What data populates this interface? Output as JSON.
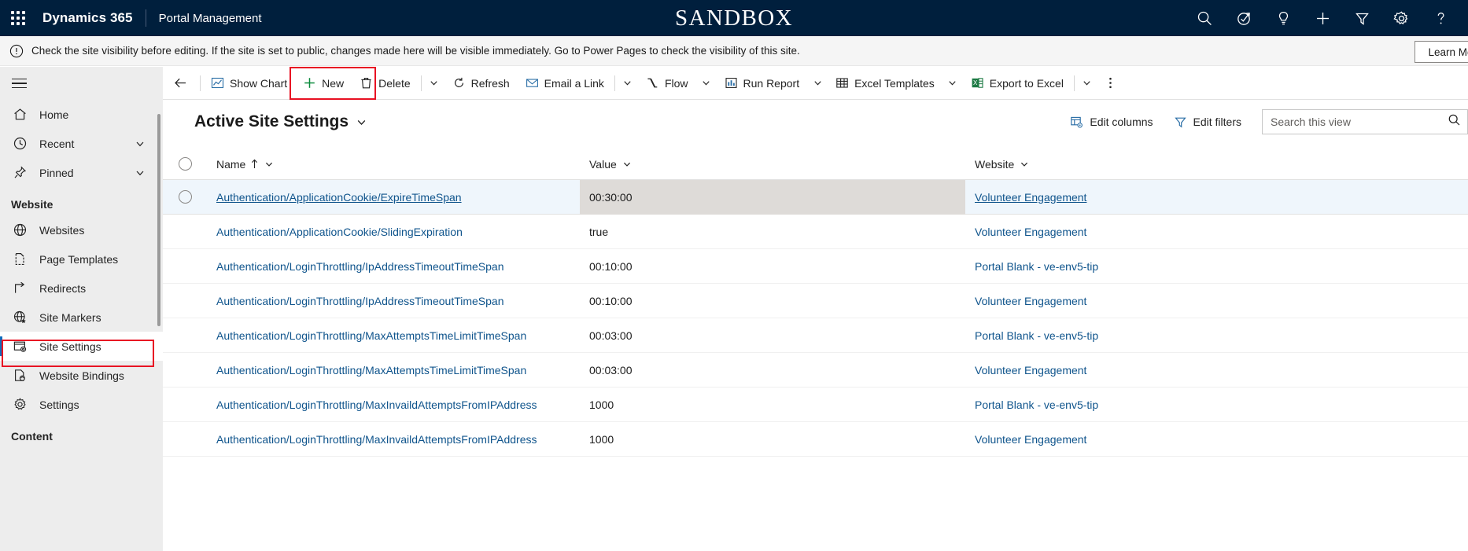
{
  "appbar": {
    "brand": "Dynamics 365",
    "app_name": "Portal Management",
    "environment_badge": "SANDBOX",
    "icons": [
      {
        "name": "search-icon",
        "label": "Search"
      },
      {
        "name": "diagnostics-icon",
        "label": "Diagnostics"
      },
      {
        "name": "lightbulb-icon",
        "label": "Assistant"
      },
      {
        "name": "plus-icon",
        "label": "Quick create"
      },
      {
        "name": "filter-icon",
        "label": "Filter"
      },
      {
        "name": "gear-icon",
        "label": "Settings"
      },
      {
        "name": "help-icon",
        "label": "Help"
      }
    ]
  },
  "notification": {
    "text": "Check the site visibility before editing. If the site is set to public, changes made here will be visible immediately. Go to Power Pages to check the visibility of this site.",
    "action_label": "Learn More"
  },
  "sidebar": {
    "top_items": [
      {
        "label": "Home",
        "icon": "home-icon",
        "chevron": false
      },
      {
        "label": "Recent",
        "icon": "clock-icon",
        "chevron": true
      },
      {
        "label": "Pinned",
        "icon": "pin-icon",
        "chevron": true
      }
    ],
    "group_website": "Website",
    "website_items": [
      {
        "label": "Websites",
        "icon": "globe-icon",
        "selected": false
      },
      {
        "label": "Page Templates",
        "icon": "page-icon",
        "selected": false
      },
      {
        "label": "Redirects",
        "icon": "redirect-icon",
        "selected": false
      },
      {
        "label": "Site Markers",
        "icon": "globe-star-icon",
        "selected": false
      },
      {
        "label": "Site Settings",
        "icon": "site-settings-icon",
        "selected": true
      },
      {
        "label": "Website Bindings",
        "icon": "binding-icon",
        "selected": false
      },
      {
        "label": "Settings",
        "icon": "gear-icon",
        "selected": false
      }
    ],
    "group_content": "Content"
  },
  "commandbar": {
    "back_label": "Back",
    "items": [
      {
        "label": "Show Chart",
        "icon": "chart-icon",
        "chevron": false,
        "sep_after": false
      },
      {
        "label": "New",
        "icon": "plus-icon",
        "chevron": false,
        "sep_after": false
      },
      {
        "label": "Delete",
        "icon": "trash-icon",
        "chevron": true,
        "sep_after": true
      },
      {
        "label": "Refresh",
        "icon": "refresh-icon",
        "chevron": false,
        "sep_after": false
      },
      {
        "label": "Email a Link",
        "icon": "email-icon",
        "chevron": true,
        "sep_after": true
      },
      {
        "label": "Flow",
        "icon": "flow-icon",
        "chevron": true,
        "sep_after": false
      },
      {
        "label": "Run Report",
        "icon": "report-icon",
        "chevron": true,
        "sep_after": false
      },
      {
        "label": "Excel Templates",
        "icon": "excel-template-icon",
        "chevron": true,
        "sep_after": false
      },
      {
        "label": "Export to Excel",
        "icon": "excel-export-icon",
        "chevron": true,
        "sep_after": true
      }
    ],
    "overflow_label": "More commands"
  },
  "view": {
    "title": "Active Site Settings",
    "edit_columns_label": "Edit columns",
    "edit_filters_label": "Edit filters",
    "search_placeholder": "Search this view",
    "search_value": ""
  },
  "grid": {
    "columns": [
      {
        "label": "Name",
        "sorted": "asc"
      },
      {
        "label": "Value",
        "sorted": ""
      },
      {
        "label": "Website",
        "sorted": ""
      }
    ],
    "rows": [
      {
        "name": "Authentication/ApplicationCookie/ExpireTimeSpan",
        "value": "00:30:00",
        "website": "Volunteer Engagement",
        "selected": true
      },
      {
        "name": "Authentication/ApplicationCookie/SlidingExpiration",
        "value": "true",
        "website": "Volunteer Engagement",
        "selected": false
      },
      {
        "name": "Authentication/LoginThrottling/IpAddressTimeoutTimeSpan",
        "value": "00:10:00",
        "website": "Portal Blank - ve-env5-tip",
        "selected": false
      },
      {
        "name": "Authentication/LoginThrottling/IpAddressTimeoutTimeSpan",
        "value": "00:10:00",
        "website": "Volunteer Engagement",
        "selected": false
      },
      {
        "name": "Authentication/LoginThrottling/MaxAttemptsTimeLimitTimeSpan",
        "value": "00:03:00",
        "website": "Portal Blank - ve-env5-tip",
        "selected": false
      },
      {
        "name": "Authentication/LoginThrottling/MaxAttemptsTimeLimitTimeSpan",
        "value": "00:03:00",
        "website": "Volunteer Engagement",
        "selected": false
      },
      {
        "name": "Authentication/LoginThrottling/MaxInvaildAttemptsFromIPAddress",
        "value": "1000",
        "website": "Portal Blank - ve-env5-tip",
        "selected": false
      },
      {
        "name": "Authentication/LoginThrottling/MaxInvaildAttemptsFromIPAddress",
        "value": "1000",
        "website": "Volunteer Engagement",
        "selected": false
      }
    ]
  },
  "colors": {
    "appbar_bg": "#001f3d",
    "accent": "#0f6cbd",
    "link": "#0f548c",
    "annotation": "#e81123",
    "selected_row": "#eff6fc",
    "selected_cell": "#dedbd8",
    "sidebar_bg": "#ededed"
  }
}
